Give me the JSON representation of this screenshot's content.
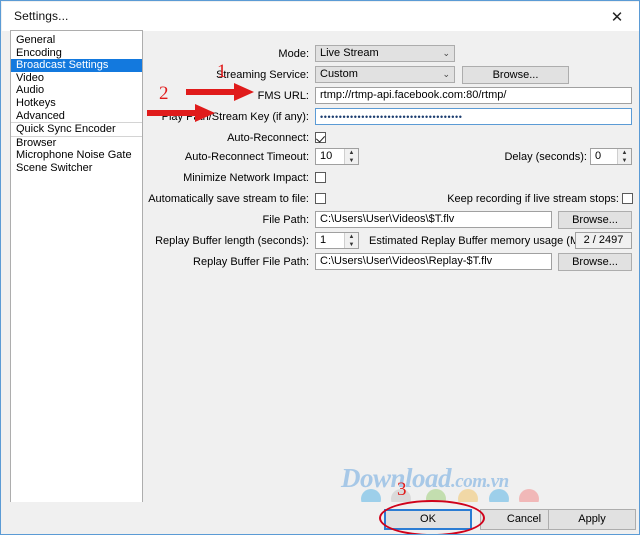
{
  "window": {
    "title": "Settings...",
    "close_icon": "close-icon"
  },
  "sidebar": {
    "items": [
      {
        "label": "General",
        "selected": false
      },
      {
        "label": "Encoding",
        "selected": false
      },
      {
        "label": "Broadcast Settings",
        "selected": true
      },
      {
        "label": "Video",
        "selected": false
      },
      {
        "label": "Audio",
        "selected": false
      },
      {
        "label": "Hotkeys",
        "selected": false
      },
      {
        "label": "Advanced",
        "selected": false
      },
      {
        "label": "Quick Sync Encoder",
        "selected": false
      },
      {
        "label": "Browser",
        "selected": false
      },
      {
        "label": "Microphone Noise Gate",
        "selected": false
      },
      {
        "label": "Scene Switcher",
        "selected": false
      }
    ]
  },
  "form": {
    "mode": {
      "label": "Mode:",
      "value": "Live Stream",
      "arrow_icon": "chevron-down-icon"
    },
    "streaming_service": {
      "label": "Streaming Service:",
      "value": "Custom",
      "arrow_icon": "chevron-down-icon",
      "browse": "Browse..."
    },
    "fms_url": {
      "label": "FMS URL:",
      "value": "rtmp://rtmp-api.facebook.com:80/rtmp/"
    },
    "stream_key": {
      "label": "Play Path/Stream Key (if any):",
      "value": "••••••••••••••••••••••••••••••••••••••"
    },
    "auto_reconnect": {
      "label": "Auto-Reconnect:",
      "checked": true
    },
    "auto_reconnect_timeout": {
      "label": "Auto-Reconnect Timeout:",
      "value": "10"
    },
    "delay": {
      "label": "Delay (seconds):",
      "value": "0"
    },
    "minimize_network_impact": {
      "label": "Minimize Network Impact:",
      "checked": false
    },
    "auto_save_stream": {
      "label": "Automatically save stream to file:",
      "checked": false
    },
    "keep_recording": {
      "label": "Keep recording if live stream stops:",
      "checked": false
    },
    "file_path": {
      "label": "File Path:",
      "value": "C:\\Users\\User\\Videos\\$T.flv",
      "browse": "Browse..."
    },
    "replay_buffer_length": {
      "label": "Replay Buffer length (seconds):",
      "value": "1"
    },
    "replay_buffer_memory": {
      "label": "Estimated Replay Buffer memory usage (MB):",
      "value": "2 / 2497"
    },
    "replay_buffer_path": {
      "label": "Replay Buffer File Path:",
      "value": "C:\\Users\\User\\Videos\\Replay-$T.flv",
      "browse": "Browse..."
    }
  },
  "footer": {
    "ok": "OK",
    "cancel": "Cancel",
    "apply": "Apply"
  },
  "annotations": {
    "one": "1",
    "two": "2",
    "three": "3",
    "color": "#d0021b"
  },
  "watermark": {
    "main": "Download",
    "suffix": ".com.vn"
  }
}
